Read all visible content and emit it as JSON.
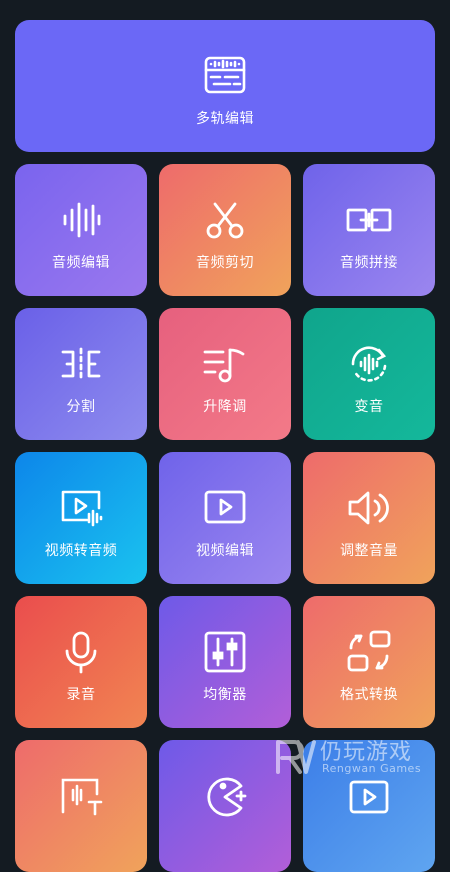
{
  "top_tile": {
    "label": "多轨编辑",
    "icon": "multitrack-icon"
  },
  "tiles": [
    {
      "label": "音频编辑",
      "icon": "audio-wave-icon"
    },
    {
      "label": "音频剪切",
      "icon": "scissors-icon"
    },
    {
      "label": "音频拼接",
      "icon": "join-icon"
    },
    {
      "label": "分割",
      "icon": "split-icon"
    },
    {
      "label": "升降调",
      "icon": "pitch-icon"
    },
    {
      "label": "变音",
      "icon": "voice-change-icon"
    },
    {
      "label": "视频转音频",
      "icon": "video-to-audio-icon"
    },
    {
      "label": "视频编辑",
      "icon": "video-edit-icon"
    },
    {
      "label": "调整音量",
      "icon": "volume-icon"
    },
    {
      "label": "录音",
      "icon": "microphone-icon"
    },
    {
      "label": "均衡器",
      "icon": "equalizer-icon"
    },
    {
      "label": "格式转换",
      "icon": "format-convert-icon"
    }
  ],
  "watermark": {
    "title": "仍玩游戏",
    "subtitle": "Rengwan Games"
  }
}
